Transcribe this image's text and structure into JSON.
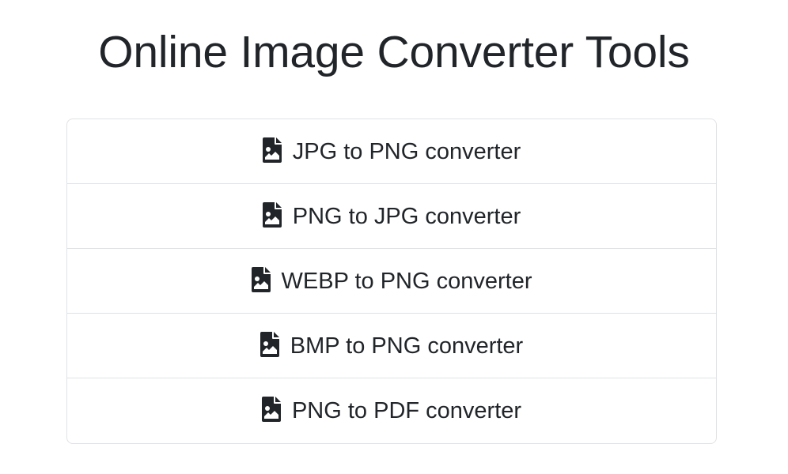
{
  "header": {
    "title": "Online Image Converter Tools"
  },
  "tools": [
    {
      "label": "JPG to PNG converter",
      "icon": "file-image-icon"
    },
    {
      "label": "PNG to JPG converter",
      "icon": "file-image-icon"
    },
    {
      "label": "WEBP to PNG converter",
      "icon": "file-image-icon"
    },
    {
      "label": "BMP to PNG converter",
      "icon": "file-image-icon"
    },
    {
      "label": "PNG to PDF converter",
      "icon": "file-image-icon"
    }
  ],
  "colors": {
    "text": "#212529",
    "border": "#dee2e6",
    "background": "#ffffff"
  }
}
